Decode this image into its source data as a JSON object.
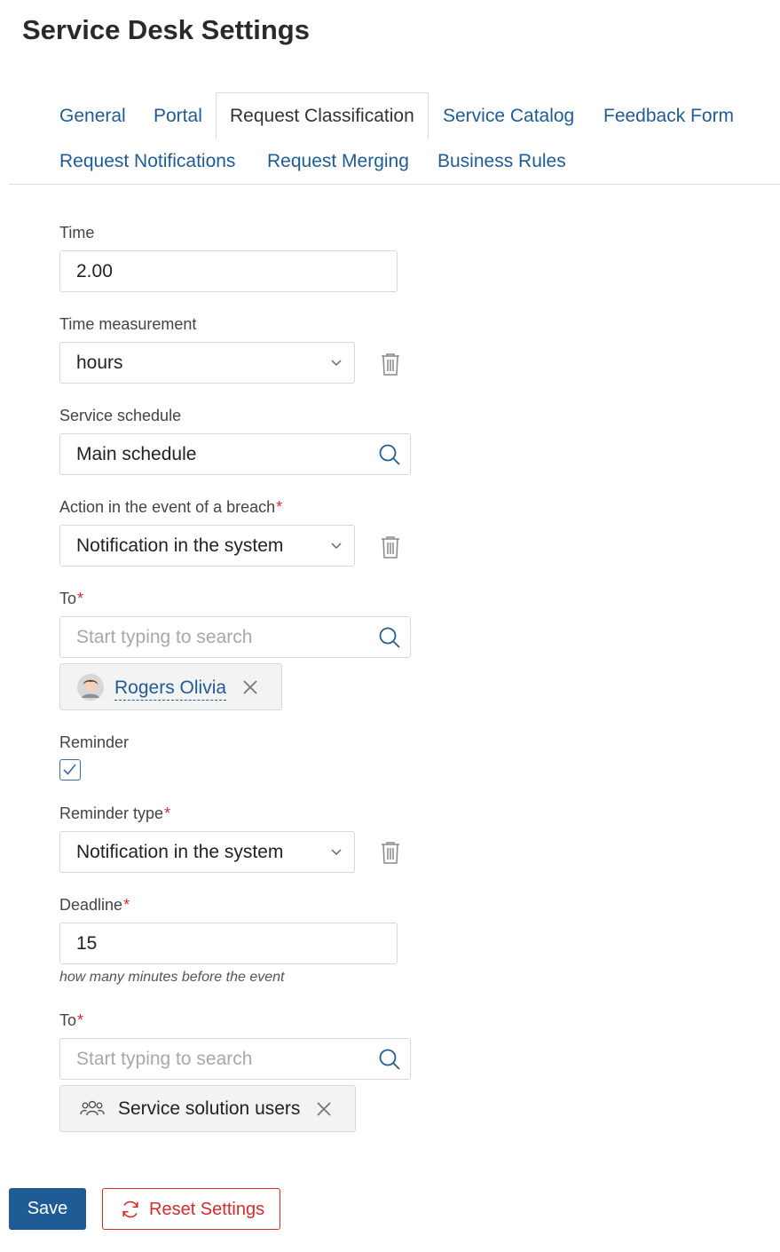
{
  "page": {
    "title": "Service Desk Settings"
  },
  "tabs": [
    {
      "label": "General"
    },
    {
      "label": "Portal"
    },
    {
      "label": "Request Classification"
    },
    {
      "label": "Service Catalog"
    },
    {
      "label": "Feedback Form"
    },
    {
      "label": "Request Notifications"
    },
    {
      "label": "Request Merging"
    },
    {
      "label": "Business Rules"
    }
  ],
  "active_tab": "Request Classification",
  "form": {
    "time": {
      "label": "Time",
      "value": "2.00"
    },
    "time_measurement": {
      "label": "Time measurement",
      "value": "hours"
    },
    "service_schedule": {
      "label": "Service schedule",
      "value": "Main schedule"
    },
    "breach_action": {
      "label": "Action in the event of a breach",
      "required_mark": "*",
      "value": "Notification in the system"
    },
    "to_1": {
      "label": "To",
      "required_mark": "*",
      "placeholder": "Start typing to search",
      "chip": {
        "label": "Rogers Olivia"
      }
    },
    "reminder": {
      "label": "Reminder",
      "checked": true
    },
    "reminder_type": {
      "label": "Reminder type",
      "required_mark": "*",
      "value": "Notification in the system"
    },
    "deadline": {
      "label": "Deadline",
      "required_mark": "*",
      "value": "15",
      "hint": "how many minutes before the event"
    },
    "to_2": {
      "label": "To",
      "required_mark": "*",
      "placeholder": "Start typing to search",
      "chip": {
        "label": "Service solution users"
      }
    }
  },
  "actions": {
    "save_label": "Save",
    "reset_label": "Reset Settings"
  },
  "colors": {
    "accent": "#1f5c96",
    "danger": "#d62b2b",
    "border": "#d9d9d9",
    "chip_bg": "#f3f3f3"
  },
  "icons": [
    "chevron-down-icon",
    "trash-icon",
    "search-icon",
    "close-icon",
    "users-group-icon",
    "refresh-icon",
    "check-icon",
    "avatar"
  ]
}
